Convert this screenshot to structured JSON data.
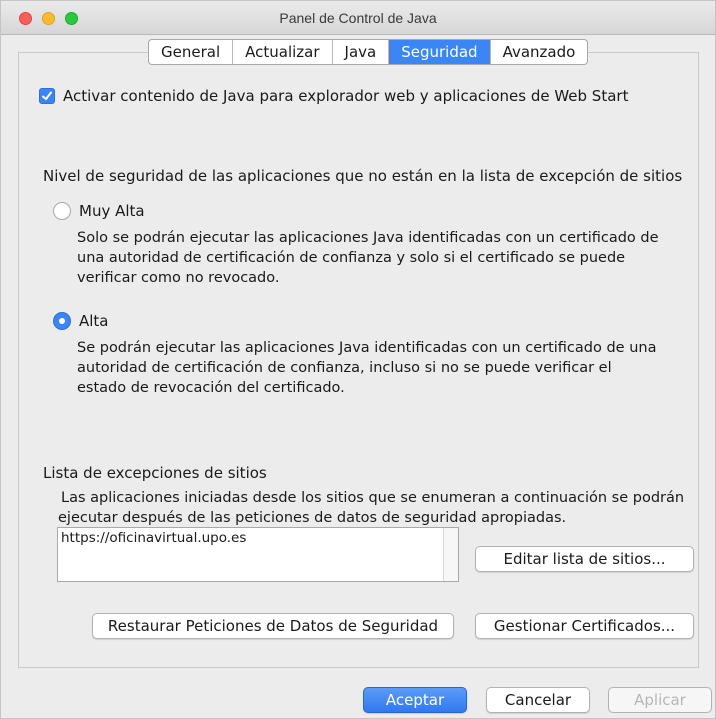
{
  "window": {
    "title": "Panel de Control de Java"
  },
  "tabs": [
    {
      "label": "General",
      "active": false
    },
    {
      "label": "Actualizar",
      "active": false
    },
    {
      "label": "Java",
      "active": false
    },
    {
      "label": "Seguridad",
      "active": true
    },
    {
      "label": "Avanzado",
      "active": false
    }
  ],
  "security": {
    "enable_checkbox": {
      "label": "Activar contenido de Java para explorador web y aplicaciones de Web Start",
      "checked": true
    },
    "level_heading": "Nivel de seguridad de las aplicaciones que no están en la lista de excepción de sitios",
    "levels": [
      {
        "label": "Muy Alta",
        "selected": false,
        "description": [
          "Solo se podrán ejecutar las aplicaciones Java identificadas con un certificado de",
          "una autoridad de certificación de confianza y solo si el certificado se puede",
          "verificar como no revocado."
        ]
      },
      {
        "label": "Alta",
        "selected": true,
        "description": [
          "Se podrán ejecutar las aplicaciones Java identificadas con un certificado de una",
          "autoridad de certificación de confianza, incluso si no se puede verificar el",
          "estado de revocación del certificado."
        ]
      }
    ],
    "exceptions": {
      "heading": "Lista de excepciones de sitios",
      "description": [
        "Las aplicaciones iniciadas desde los sitios que se enumeran a continuación se podrán",
        "ejecutar después de las peticiones de datos de seguridad apropiadas."
      ],
      "sites": [
        "https://oficinavirtual.upo.es"
      ],
      "edit_button": "Editar lista de sitios..."
    },
    "restore_button": "Restaurar Peticiones de Datos de Seguridad",
    "certificates_button": "Gestionar Certificados..."
  },
  "footer": {
    "accept": "Aceptar",
    "cancel": "Cancelar",
    "apply": "Aplicar"
  },
  "colors": {
    "accent": "#3b86f7",
    "window_bg": "#ececec"
  }
}
